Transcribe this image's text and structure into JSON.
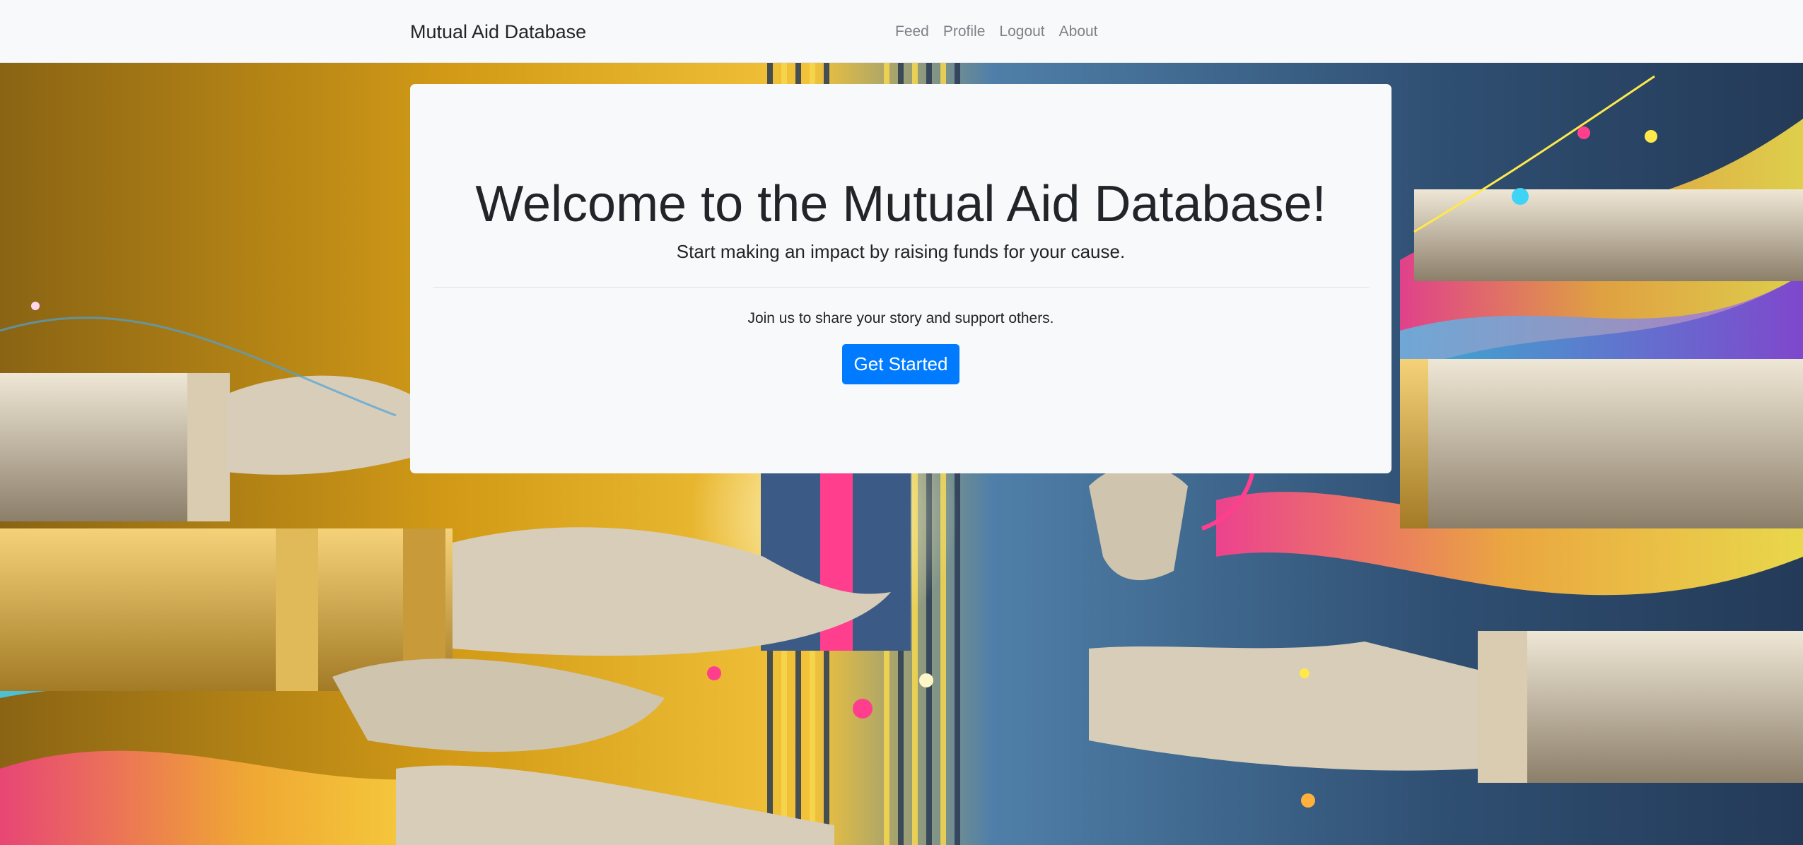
{
  "navbar": {
    "brand": "Mutual Aid Database",
    "links": [
      "Feed",
      "Profile",
      "Logout",
      "About"
    ]
  },
  "hero": {
    "image": "hands-giving-gift-illustration",
    "palette": {
      "left": "#d9a21a",
      "right": "#3f6f9c",
      "accent_pink": "#ff3e8e",
      "accent_cyan": "#3fd3f5"
    }
  },
  "jumbotron": {
    "title": "Welcome to the Mutual Aid Database!",
    "lead": "Start making an impact by raising funds for your cause.",
    "body": "Join us to share your story and support others.",
    "cta_label": "Get Started",
    "cta_color": "#007bff"
  }
}
